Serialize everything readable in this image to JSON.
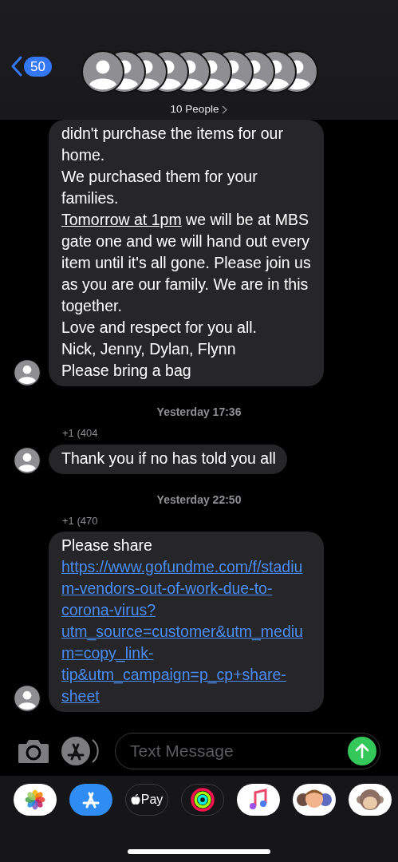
{
  "header": {
    "back_count": "50",
    "avatars": [
      {
        "kind": "person"
      },
      {
        "kind": "person"
      },
      {
        "kind": "person"
      },
      {
        "kind": "person"
      },
      {
        "kind": "person"
      },
      {
        "kind": "person"
      },
      {
        "kind": "person"
      },
      {
        "kind": "person"
      },
      {
        "kind": "person"
      },
      {
        "kind": "person"
      }
    ],
    "people_label": "10 People"
  },
  "thread": [
    {
      "kind": "message",
      "parts": [
        {
          "kind": "text",
          "text": "didn't purchase the items for our home.\nWe purchased them for your families.\n"
        },
        {
          "kind": "link",
          "text": "Tomorrow at 1pm"
        },
        {
          "kind": "text",
          "text": " we will be at MBS gate one and we will hand out every item until it's all gone. Please join us as you are our family. We are in this together.\nLove and respect for you all.\nNick, Jenny, Dylan, Flynn\nPlease bring a bag"
        }
      ]
    },
    {
      "kind": "timestamp",
      "text": "Yesterday 17:36"
    },
    {
      "kind": "sender",
      "text": "+1 (404"
    },
    {
      "kind": "message",
      "parts": [
        {
          "kind": "text",
          "text": "Thank you if no has told you all"
        }
      ]
    },
    {
      "kind": "timestamp",
      "text": "Yesterday 22:50"
    },
    {
      "kind": "sender",
      "text": "+1 (470"
    },
    {
      "kind": "message",
      "parts": [
        {
          "kind": "text",
          "text": "Please share\n"
        },
        {
          "kind": "link",
          "text": "https://www.gofundme.com/f/stadium-vendors-out-of-work-due-to-corona-virus?utm_source=customer&utm_medium=copy_link-tip&utm_campaign=p_cp+share-sheet"
        }
      ]
    }
  ],
  "composer": {
    "placeholder": "Text Message"
  },
  "app_strip": [
    {
      "kind": "photos"
    },
    {
      "kind": "appstore"
    },
    {
      "kind": "pay",
      "label": "Pay"
    },
    {
      "kind": "activity"
    },
    {
      "kind": "music"
    },
    {
      "kind": "memoji"
    },
    {
      "kind": "animoji"
    }
  ]
}
